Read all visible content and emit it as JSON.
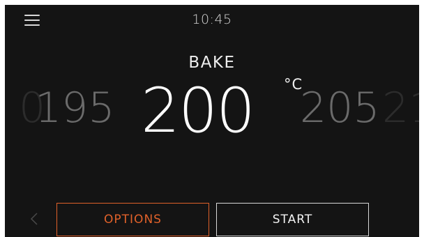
{
  "status_bar": {
    "menu_icon": "hamburger-menu-icon",
    "time": "10:45"
  },
  "cooking": {
    "mode": "BAKE",
    "unit": "°C",
    "temperatures": {
      "far_left": "0",
      "left": "195",
      "selected": "200",
      "right": "205",
      "far_right": "21"
    }
  },
  "footer": {
    "back_icon": "chevron-left-icon",
    "options_label": "OPTIONS",
    "start_label": "START"
  },
  "colors": {
    "background": "#141414",
    "accent": "#e0612a",
    "text": "#ffffff",
    "dim_text": "#6b6b6b"
  }
}
